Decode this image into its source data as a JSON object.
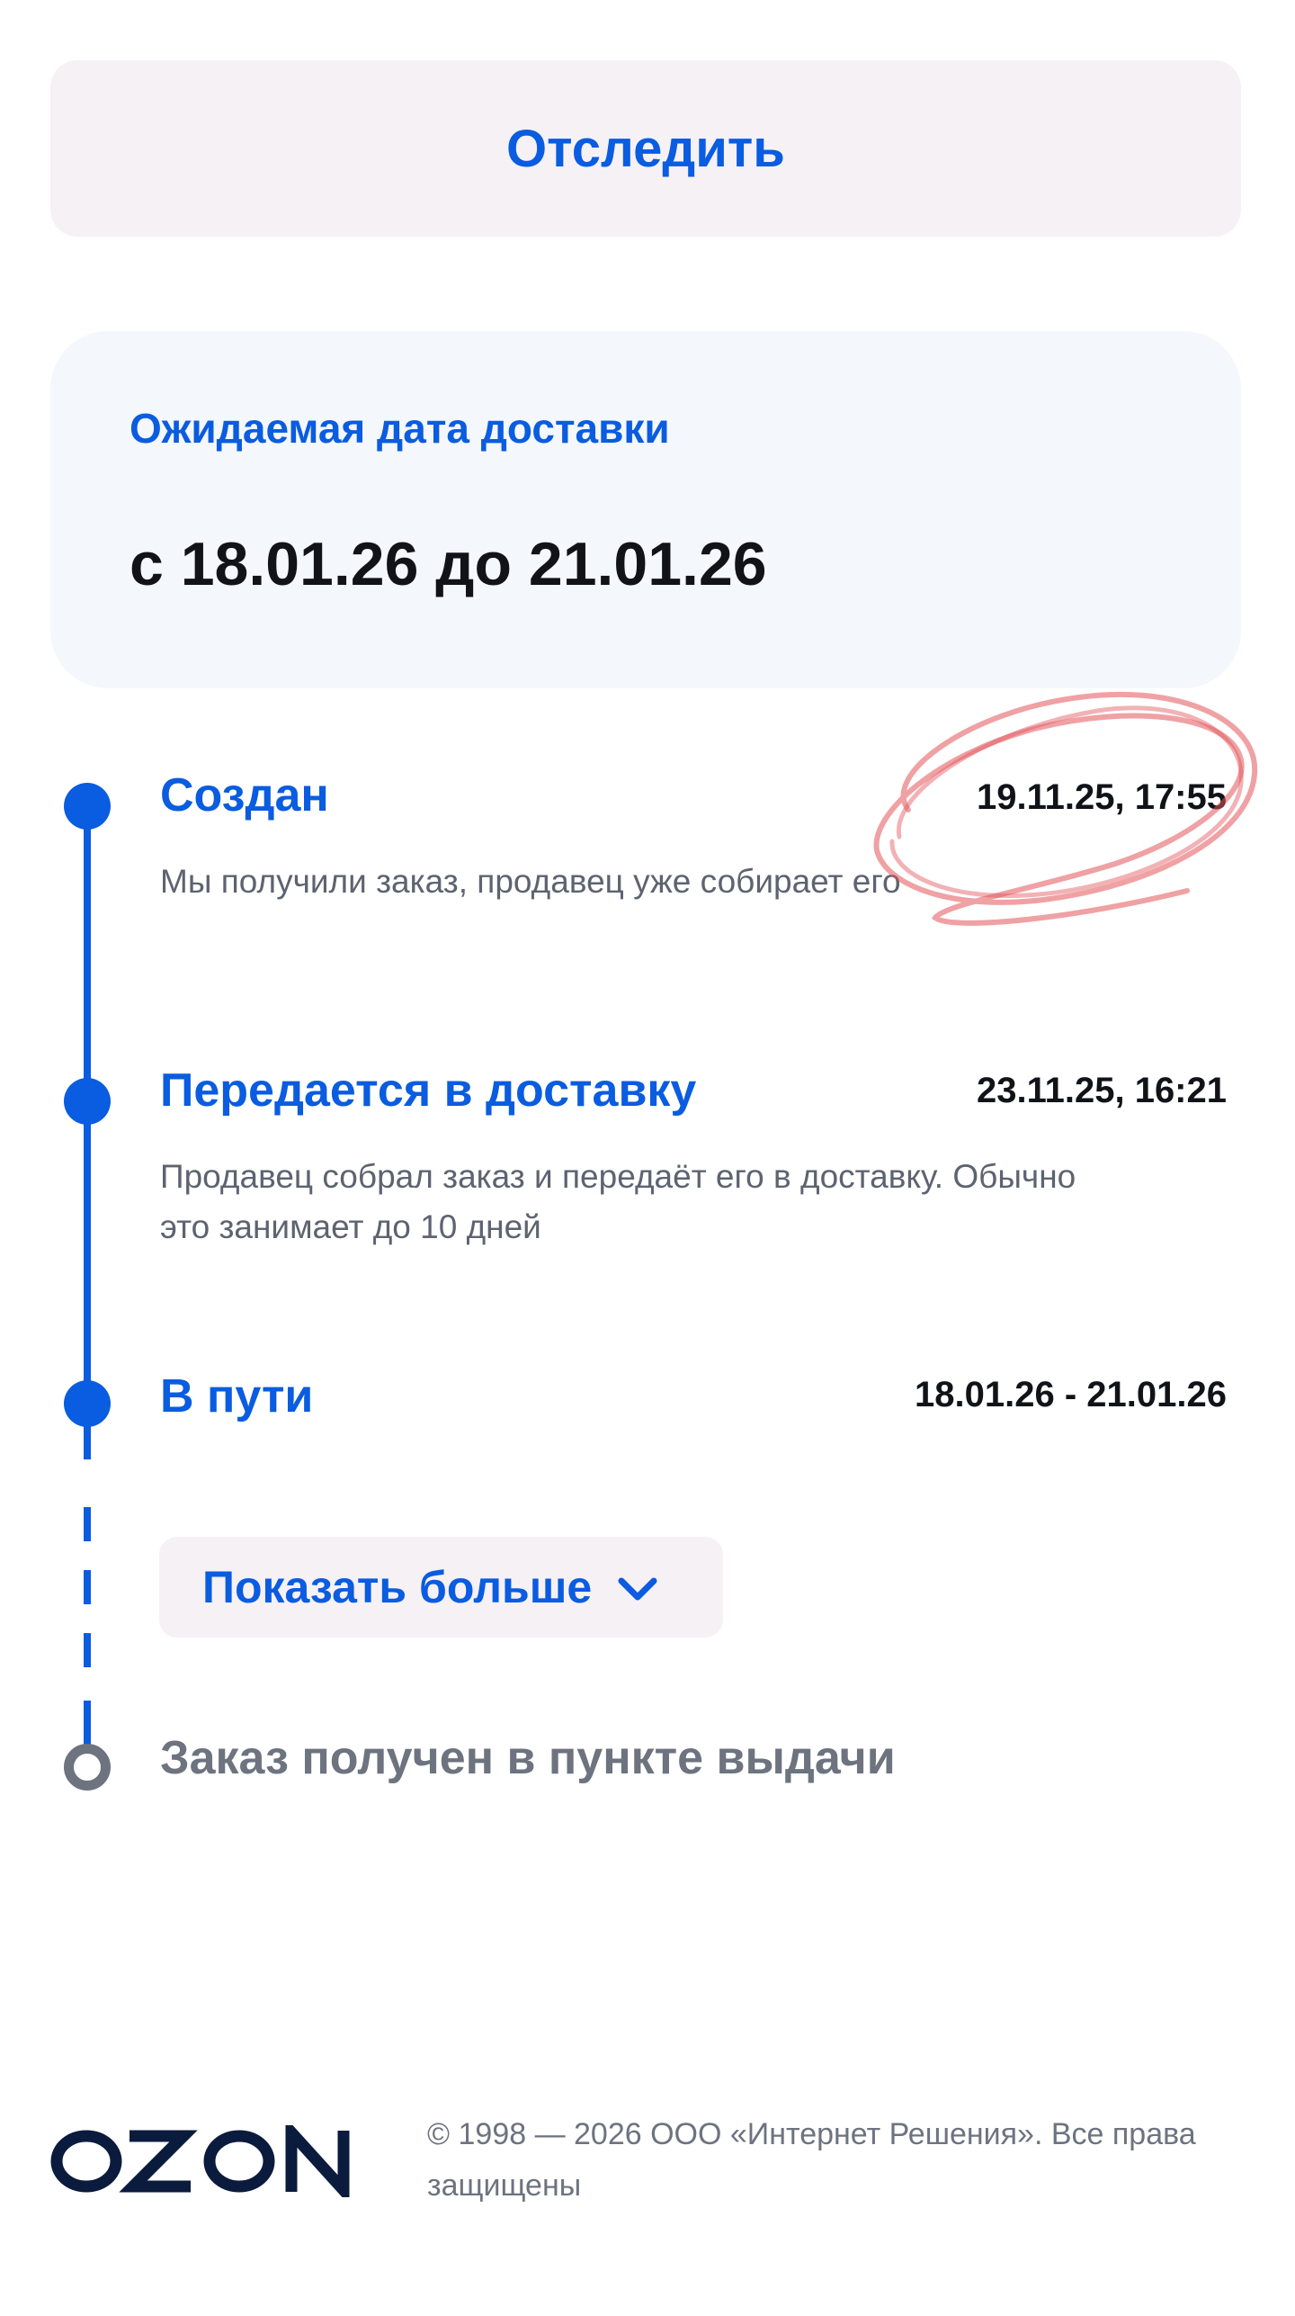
{
  "track_button": {
    "label": "Отследить"
  },
  "delivery": {
    "label": "Ожидаемая дата доставки",
    "range": "с 18.01.26 до 21.01.26"
  },
  "steps": [
    {
      "title": "Создан",
      "time": "19.11.25, 17:55",
      "description": "Мы получили заказ, продавец уже собирает его"
    },
    {
      "title": "Передается в доставку",
      "time": "23.11.25, 16:21",
      "description_lines": [
        "Продавец собрал заказ и передаёт его в доставку. Обычно",
        "это занимает до 10 дней"
      ]
    },
    {
      "title": "В пути",
      "time": "18.01.26 - 21.01.26"
    }
  ],
  "show_more": {
    "label": "Показать больше",
    "icon": "chevron-down-icon"
  },
  "final_step": {
    "title": "Заказ получен в пункте выдачи"
  },
  "footer": {
    "logo_text": "OZON",
    "copyright_lines": [
      "© 1998 — 2026 ООО «Интернет Решения». Все права",
      "защищены"
    ]
  },
  "colors": {
    "accent": "#0a5ce0",
    "muted": "#6d737f",
    "text": "#111318",
    "annotation": "#e2545a"
  }
}
